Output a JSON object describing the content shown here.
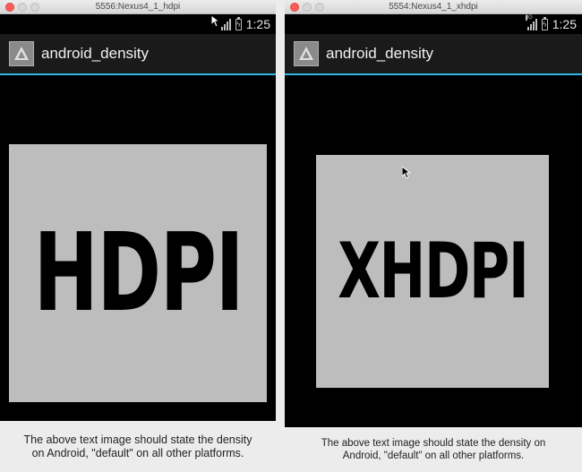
{
  "windows": [
    {
      "title": "5556:Nexus4_1_hdpi",
      "status": {
        "time": "1:25",
        "network": ""
      },
      "app": {
        "title": "android_density"
      },
      "image_text": "HDPI",
      "caption": "The above text image should state the density on Android, \"default\" on all other platforms."
    },
    {
      "title": "5554:Nexus4_1_xhdpi",
      "status": {
        "time": "1:25",
        "network": "3G"
      },
      "app": {
        "title": "android_density"
      },
      "image_text": "XHDPI",
      "caption": "The above text image should state the density on Android, \"default\" on all other platforms."
    }
  ],
  "colors": {
    "accent": "#33b5e5",
    "image_bg": "#bdbdbd",
    "close_button": "#fc5f57"
  }
}
